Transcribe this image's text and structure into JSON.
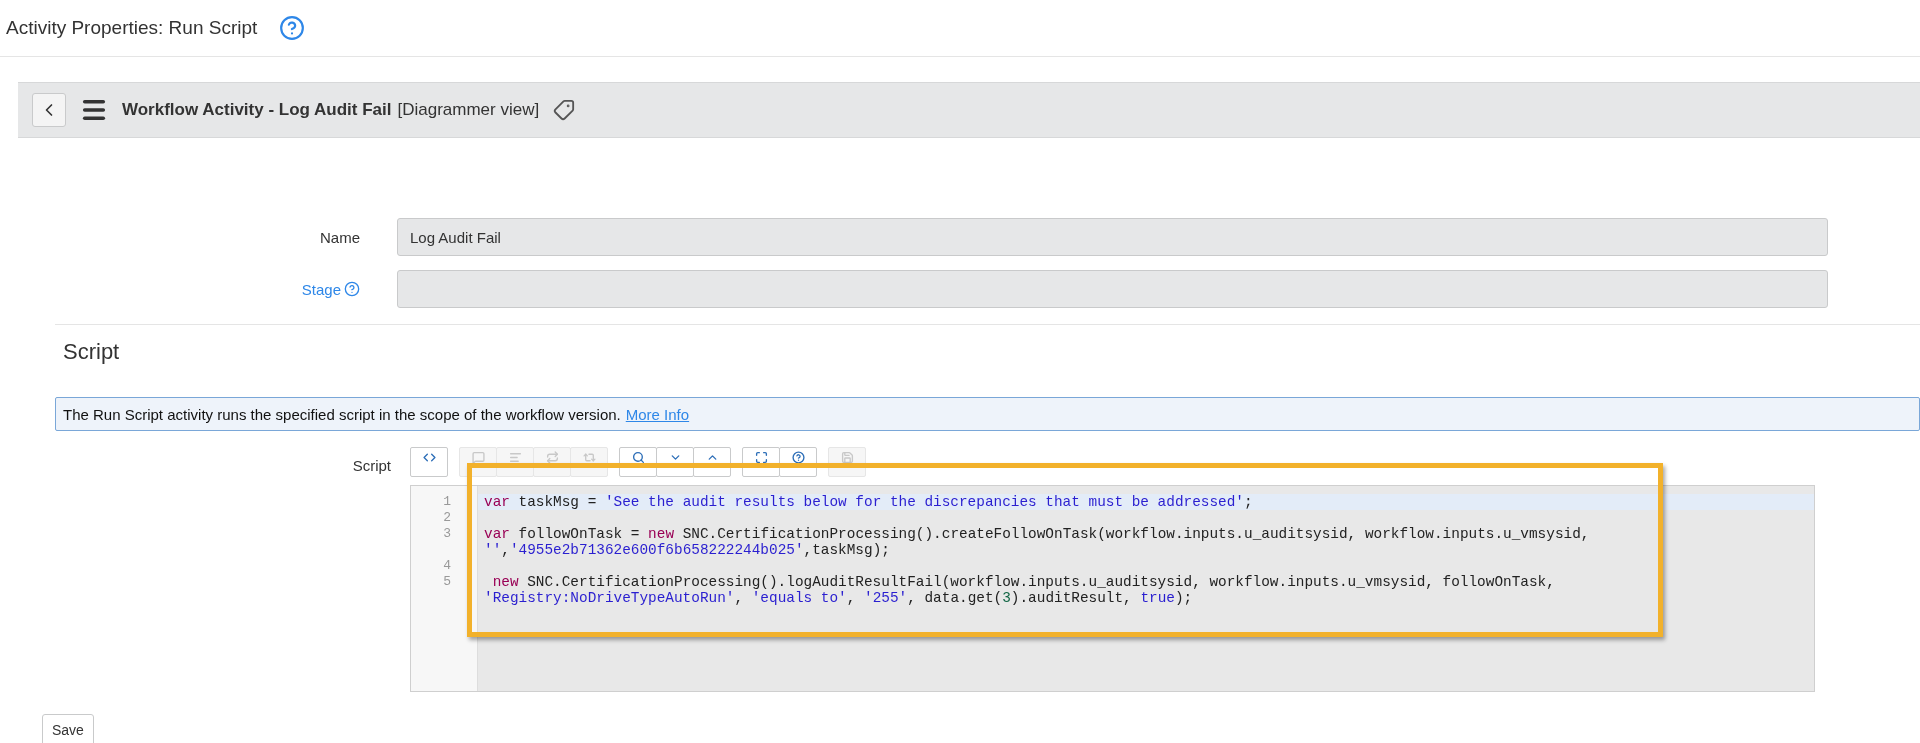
{
  "page": {
    "title": "Activity Properties: Run Script"
  },
  "header": {
    "title": "Workflow Activity - Log Audit Fail",
    "subtitle": "[Diagrammer view]"
  },
  "form": {
    "fields": [
      {
        "label": "Name",
        "kind": "plain",
        "value": "Log Audit Fail"
      },
      {
        "label": "Stage",
        "kind": "link"
      }
    ]
  },
  "section": {
    "title": "Script"
  },
  "info": {
    "text": "The Run Script activity runs the specified script in the scope of the workflow version.",
    "link": "More Info"
  },
  "editor": {
    "label": "Script",
    "toolbar": [
      [
        {
          "disabled": false
        }
      ],
      [
        {
          "disabled": true
        },
        {
          "disabled": true
        },
        {
          "disabled": true
        },
        {
          "disabled": true
        }
      ],
      [
        {
          "disabled": false
        },
        {
          "disabled": false
        },
        {
          "disabled": false
        }
      ],
      [
        {
          "disabled": false
        },
        {
          "disabled": false
        }
      ],
      [
        {
          "disabled": true
        }
      ]
    ],
    "rows": [
      {
        "number": "1",
        "selected": true,
        "tokens": [
          {
            "kind": "keyword",
            "text": "var"
          },
          {
            "kind": "plain",
            "text": " taskMsg = "
          },
          {
            "kind": "string",
            "text": "'See the audit results below for the discrepancies that must be addressed'"
          },
          {
            "kind": "plain",
            "text": ";"
          }
        ]
      },
      {
        "number": "2",
        "selected": false,
        "tokens": []
      },
      {
        "number": "3",
        "selected": false,
        "tokens": [
          {
            "kind": "keyword",
            "text": "var"
          },
          {
            "kind": "plain",
            "text": " followOnTask = "
          },
          {
            "kind": "keyword",
            "text": "new"
          },
          {
            "kind": "plain",
            "text": " SNC.CertificationProcessing().createFollowOnTask(workflow.inputs.u_auditsysid, workflow.inputs.u_vmsysid,"
          }
        ]
      },
      {
        "selected": false,
        "tokens": [
          {
            "kind": "string",
            "text": "''"
          },
          {
            "kind": "plain",
            "text": ","
          },
          {
            "kind": "string",
            "text": "'4955e2b71362e600f6b658222244b025'"
          },
          {
            "kind": "plain",
            "text": ",taskMsg);"
          }
        ]
      },
      {
        "number": "4",
        "selected": false,
        "tokens": []
      },
      {
        "number": "5",
        "selected": false,
        "tokens": [
          {
            "kind": "keyword",
            "text": " new"
          },
          {
            "kind": "plain",
            "text": " SNC.CertificationProcessing().logAuditResultFail(workflow.inputs.u_auditsysid, workflow.inputs.u_vmsysid, followOnTask,"
          }
        ]
      },
      {
        "selected": false,
        "tokens": [
          {
            "kind": "string",
            "text": "'Registry:NoDriveTypeAutoRun'"
          },
          {
            "kind": "plain",
            "text": ", "
          },
          {
            "kind": "string",
            "text": "'equals to'"
          },
          {
            "kind": "plain",
            "text": ", "
          },
          {
            "kind": "string",
            "text": "'255'"
          },
          {
            "kind": "plain",
            "text": ", data.get("
          },
          {
            "kind": "number",
            "text": "3"
          },
          {
            "kind": "plain",
            "text": ").auditResult, "
          },
          {
            "kind": "atom",
            "text": "true"
          },
          {
            "kind": "plain",
            "text": ");"
          }
        ]
      }
    ]
  },
  "buttons": [
    {
      "label": "Save"
    }
  ]
}
